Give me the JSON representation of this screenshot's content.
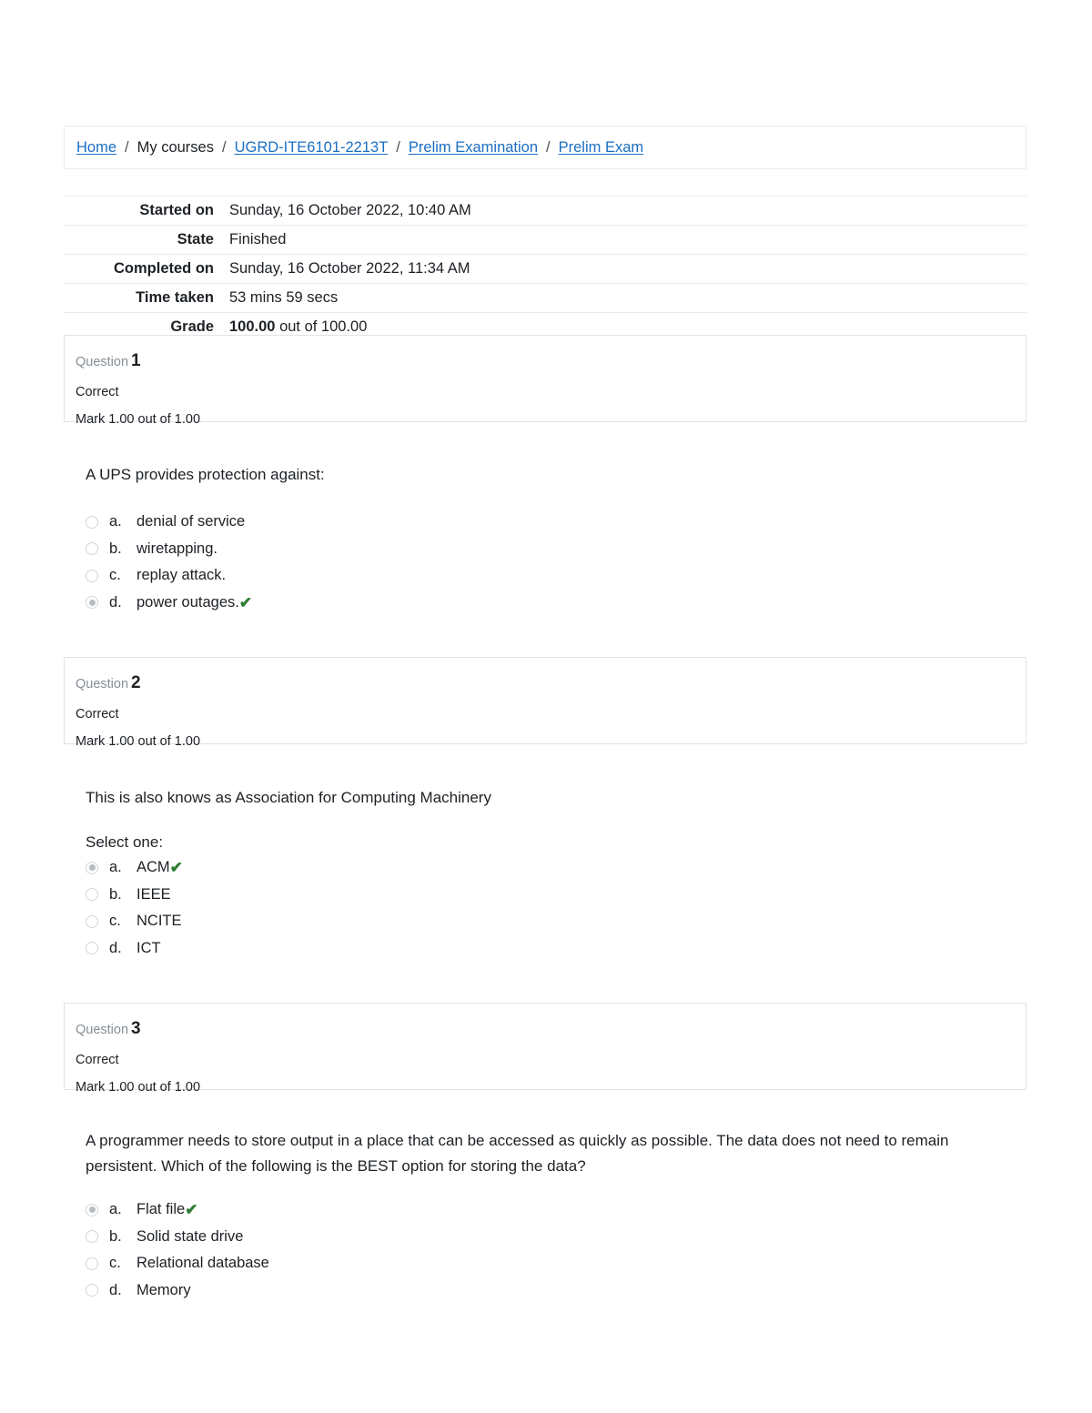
{
  "breadcrumb": {
    "items": [
      {
        "label": "Home",
        "link": true
      },
      {
        "label": "My courses",
        "link": false
      },
      {
        "label": "UGRD-ITE6101-2213T",
        "link": true
      },
      {
        "label": "Prelim Examination",
        "link": true
      },
      {
        "label": "Prelim Exam",
        "link": true
      }
    ],
    "separator": "/"
  },
  "summary": {
    "rows": [
      {
        "label": "Started on",
        "value": "Sunday, 16 October 2022, 10:40 AM"
      },
      {
        "label": "State",
        "value": "Finished"
      },
      {
        "label": "Completed on",
        "value": "Sunday, 16 October 2022, 11:34 AM"
      },
      {
        "label": "Time taken",
        "value": "53 mins 59 secs"
      }
    ],
    "grade": {
      "label": "Grade",
      "score": "100.00",
      "suffix": "out of 100.00"
    }
  },
  "questions": [
    {
      "number_label": "Question",
      "number": "1",
      "state": "Correct",
      "mark": "Mark 1.00 out of 1.00",
      "text": "A UPS provides protection against:",
      "select_one": "",
      "options": [
        {
          "letter": "a.",
          "text": "denial of service",
          "selected": false,
          "correct": false
        },
        {
          "letter": "b.",
          "text": "wiretapping.",
          "selected": false,
          "correct": false
        },
        {
          "letter": "c.",
          "text": "replay attack.",
          "selected": false,
          "correct": false
        },
        {
          "letter": "d.",
          "text": "power outages.",
          "selected": true,
          "correct": true
        }
      ]
    },
    {
      "number_label": "Question",
      "number": "2",
      "state": "Correct",
      "mark": "Mark 1.00 out of 1.00",
      "text": "This is also knows as Association for Computing Machinery",
      "select_one": "Select one:",
      "options": [
        {
          "letter": "a.",
          "text": "ACM",
          "selected": true,
          "correct": true
        },
        {
          "letter": "b.",
          "text": "IEEE",
          "selected": false,
          "correct": false
        },
        {
          "letter": "c.",
          "text": "NCITE",
          "selected": false,
          "correct": false
        },
        {
          "letter": "d.",
          "text": "ICT",
          "selected": false,
          "correct": false
        }
      ]
    },
    {
      "number_label": "Question",
      "number": "3",
      "state": "Correct",
      "mark": "Mark 1.00 out of 1.00",
      "text": "A programmer needs to store output in a place that can be accessed as quickly as possible. The data does not need to remain persistent. Which of the following is the BEST option for storing the data?",
      "select_one": "",
      "options": [
        {
          "letter": "a.",
          "text": "Flat file",
          "selected": true,
          "correct": true
        },
        {
          "letter": "b.",
          "text": "Solid state drive",
          "selected": false,
          "correct": false
        },
        {
          "letter": "c.",
          "text": "Relational database",
          "selected": false,
          "correct": false
        },
        {
          "letter": "d.",
          "text": "Memory",
          "selected": false,
          "correct": false
        }
      ]
    }
  ],
  "icons": {
    "correct_mark": "✔"
  },
  "colors": {
    "link": "#1b6ec2",
    "correct_green": "#2e7d32",
    "border": "#e9ecef"
  }
}
